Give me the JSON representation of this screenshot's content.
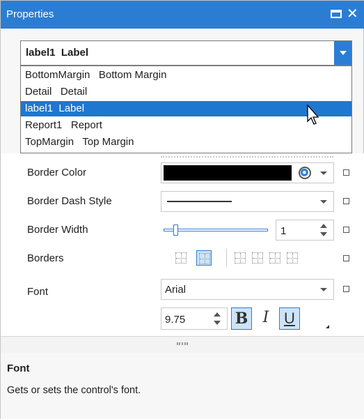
{
  "window": {
    "title": "Properties",
    "maximize_icon": "maximize-icon",
    "close_icon": "close-icon"
  },
  "selector": {
    "value": "label1  Label",
    "dropdown_icon": "chevron-down-icon",
    "items": [
      {
        "label": "BottomMargin   Bottom Margin",
        "selected": false
      },
      {
        "label": "Detail   Detail",
        "selected": false
      },
      {
        "label": "label1  Label",
        "selected": true
      },
      {
        "label": "Report1   Report",
        "selected": false
      },
      {
        "label": "TopMargin   Top Margin",
        "selected": false
      }
    ]
  },
  "properties": {
    "border_color": {
      "label": "Border Color",
      "value_color": "#000000"
    },
    "border_dash_style": {
      "label": "Border Dash Style",
      "value": "solid"
    },
    "border_width": {
      "label": "Border Width",
      "value": "1",
      "slider_fraction": 0.1
    },
    "borders": {
      "label": "Borders"
    },
    "font": {
      "label": "Font",
      "family": "Arial",
      "size": "9.75",
      "bold": true,
      "italic": false,
      "underline": true,
      "bold_label": "B",
      "italic_label": "I",
      "underline_label": "U"
    }
  },
  "description": {
    "title": "Font",
    "text": "Gets or sets the control's font."
  },
  "colors": {
    "accent": "#2b7dd4",
    "selection": "#1f77d0",
    "toggle_on": "#cce4f7"
  }
}
